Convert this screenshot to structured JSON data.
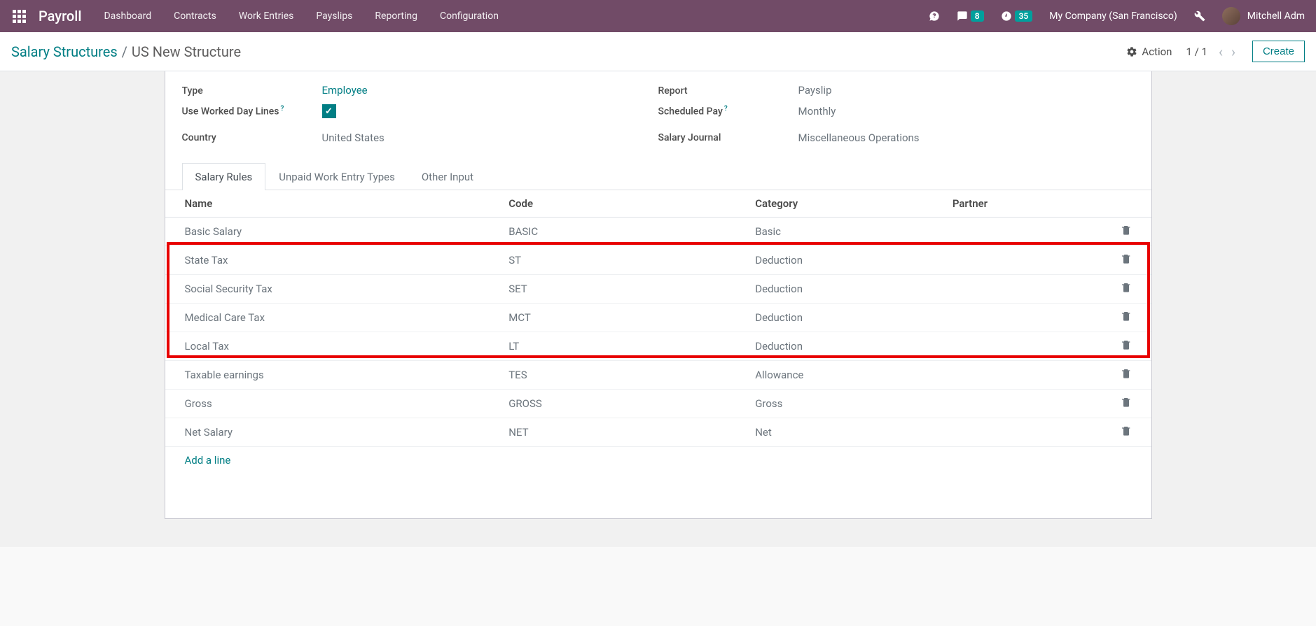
{
  "navbar": {
    "brand": "Payroll",
    "items": [
      "Dashboard",
      "Contracts",
      "Work Entries",
      "Payslips",
      "Reporting",
      "Configuration"
    ],
    "chat_count": "8",
    "clock_count": "35",
    "company": "My Company (San Francisco)",
    "user": "Mitchell Adm"
  },
  "breadcrumb": {
    "parent": "Salary Structures",
    "current": "US New Structure"
  },
  "control": {
    "action_label": "Action",
    "pager": "1 / 1",
    "create_label": "Create"
  },
  "form": {
    "type_label": "Type",
    "type_value": "Employee",
    "worked_label": "Use Worked Day Lines",
    "country_label": "Country",
    "country_value": "United States",
    "report_label": "Report",
    "report_value": "Payslip",
    "scheduled_label": "Scheduled Pay",
    "scheduled_value": "Monthly",
    "journal_label": "Salary Journal",
    "journal_value": "Miscellaneous Operations"
  },
  "tabs": [
    "Salary Rules",
    "Unpaid Work Entry Types",
    "Other Input"
  ],
  "table": {
    "headers": [
      "Name",
      "Code",
      "Category",
      "Partner"
    ],
    "rows": [
      {
        "name": "Basic Salary",
        "code": "BASIC",
        "category": "Basic",
        "partner": ""
      },
      {
        "name": "State Tax",
        "code": "ST",
        "category": "Deduction",
        "partner": ""
      },
      {
        "name": "Social Security Tax",
        "code": "SET",
        "category": "Deduction",
        "partner": ""
      },
      {
        "name": "Medical Care Tax",
        "code": "MCT",
        "category": "Deduction",
        "partner": ""
      },
      {
        "name": "Local Tax",
        "code": "LT",
        "category": "Deduction",
        "partner": ""
      },
      {
        "name": "Taxable earnings",
        "code": "TES",
        "category": "Allowance",
        "partner": ""
      },
      {
        "name": "Gross",
        "code": "GROSS",
        "category": "Gross",
        "partner": ""
      },
      {
        "name": "Net Salary",
        "code": "NET",
        "category": "Net",
        "partner": ""
      }
    ],
    "add_line": "Add a line"
  }
}
